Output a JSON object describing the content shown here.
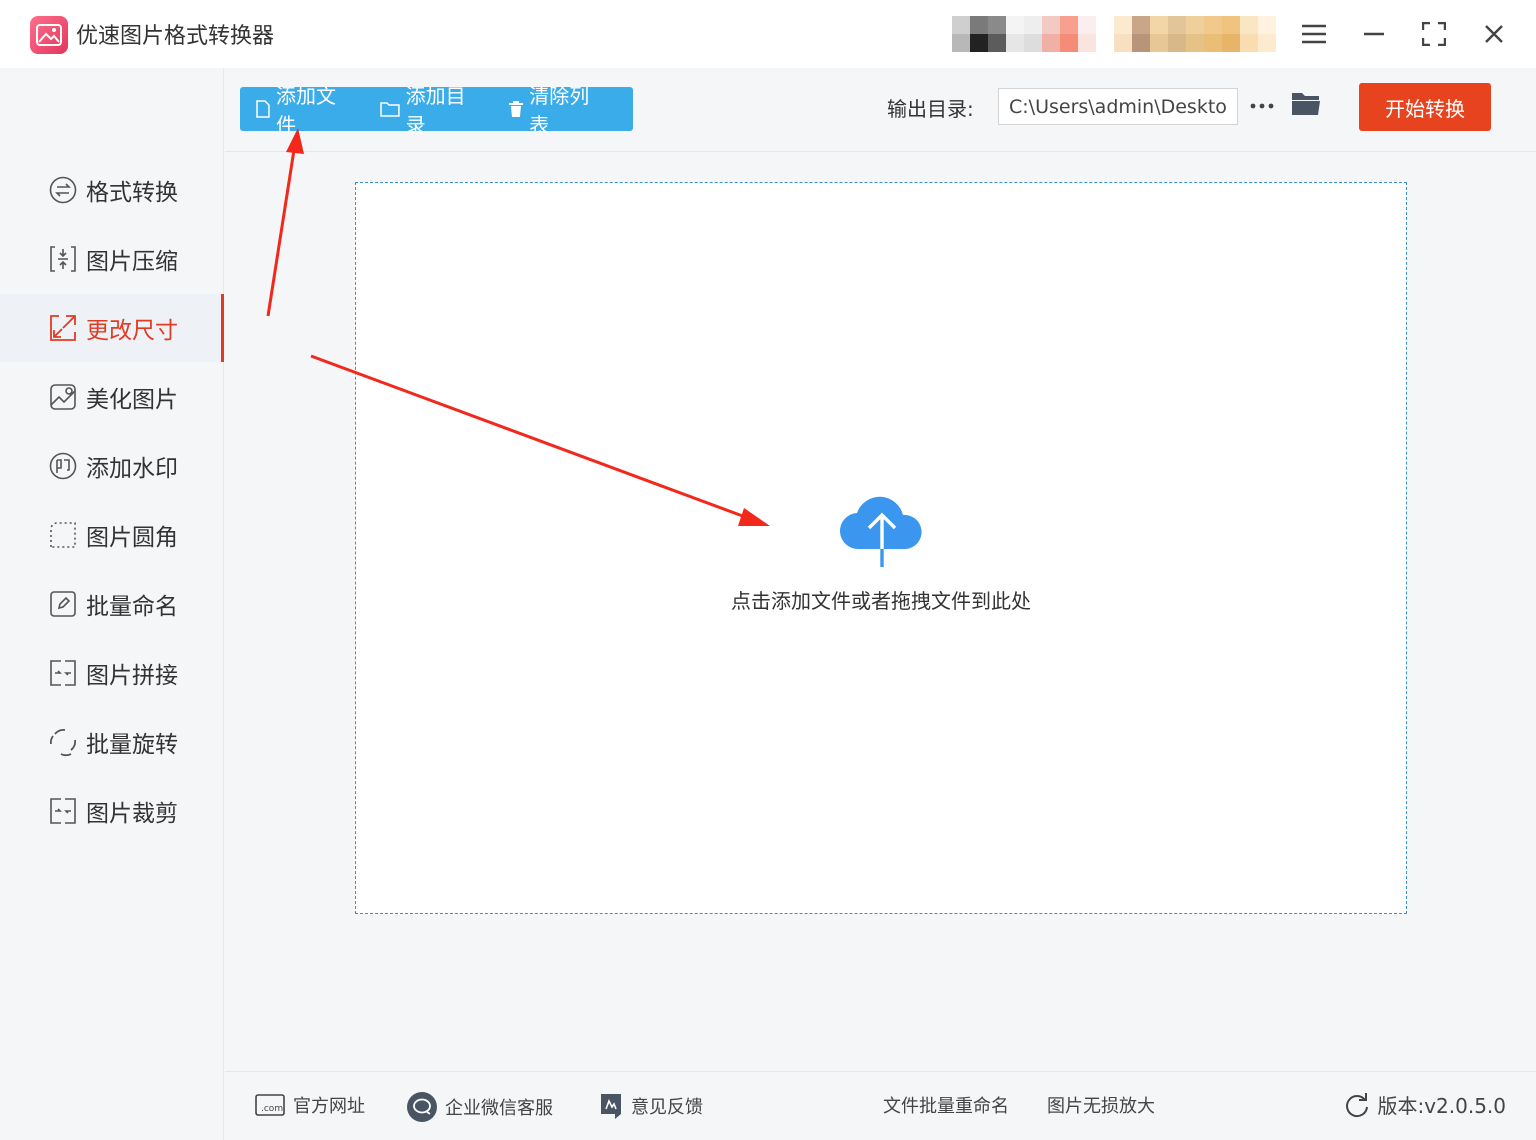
{
  "window": {
    "title": "优速图片格式转换器"
  },
  "colors": {
    "accent_blue": "#3aacea",
    "accent_red": "#e8431f",
    "active_text": "#e23b22"
  },
  "sidebar": {
    "items": [
      {
        "label": "格式转换",
        "icon": "format-convert-icon",
        "active": false
      },
      {
        "label": "图片压缩",
        "icon": "compress-icon",
        "active": false
      },
      {
        "label": "更改尺寸",
        "icon": "resize-icon",
        "active": true
      },
      {
        "label": "美化图片",
        "icon": "beautify-icon",
        "active": false
      },
      {
        "label": "添加水印",
        "icon": "watermark-icon",
        "active": false
      },
      {
        "label": "图片圆角",
        "icon": "rounded-corner-icon",
        "active": false
      },
      {
        "label": "批量命名",
        "icon": "rename-icon",
        "active": false
      },
      {
        "label": "图片拼接",
        "icon": "stitch-icon",
        "active": false
      },
      {
        "label": "批量旋转",
        "icon": "rotate-icon",
        "active": false
      },
      {
        "label": "图片裁剪",
        "icon": "crop-icon",
        "active": false
      }
    ]
  },
  "toolbar": {
    "add_file": "添加文件",
    "add_folder": "添加目录",
    "clear_list": "清除列表",
    "output_label": "输出目录:",
    "output_path": "C:\\Users\\admin\\Deskto",
    "start_label": "开始转换"
  },
  "dropzone": {
    "hint": "点击添加文件或者拖拽文件到此处"
  },
  "footer": {
    "website": "官方网址",
    "wechat": "企业微信客服",
    "feedback": "意见反馈",
    "batch_rename": "文件批量重命名",
    "lossless_enlarge": "图片无损放大",
    "version": "版本:v2.0.5.0"
  }
}
